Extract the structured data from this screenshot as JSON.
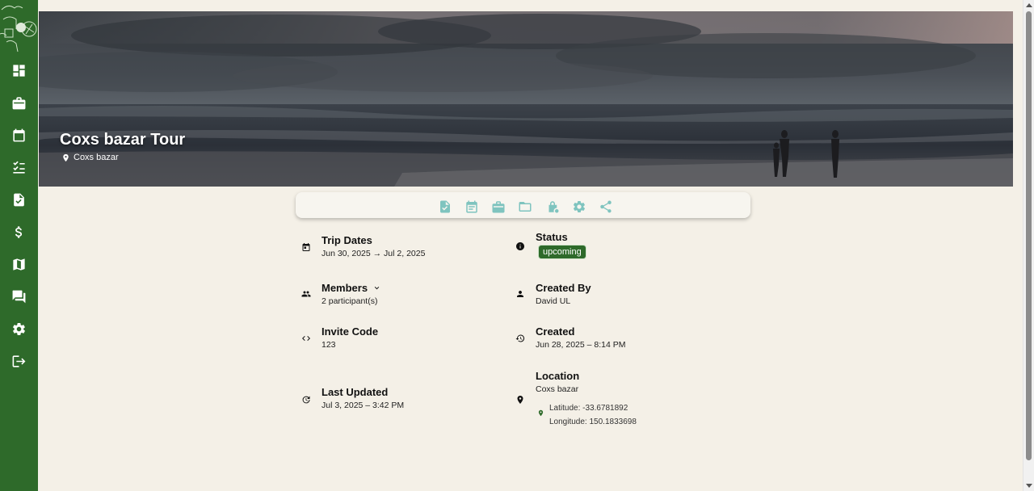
{
  "trip": {
    "title": "Coxs bazar Tour",
    "location": "Coxs bazar"
  },
  "toolbar": {
    "buttons": [
      "checklist",
      "itinerary",
      "luggage",
      "folder",
      "lock-settings",
      "settings",
      "share"
    ],
    "accent": "#7fc4bf"
  },
  "info": {
    "trip_dates": {
      "label": "Trip Dates",
      "value": "Jun 30, 2025 → Jul 2, 2025"
    },
    "status": {
      "label": "Status",
      "value": "upcoming"
    },
    "members": {
      "label": "Members",
      "value": "2 participant(s)"
    },
    "created_by": {
      "label": "Created By",
      "value": "David UL"
    },
    "invite_code": {
      "label": "Invite Code",
      "value": "123"
    },
    "created": {
      "label": "Created",
      "value": "Jun 28, 2025 – 8:14 PM"
    },
    "last_updated": {
      "label": "Last Updated",
      "value": "Jul 3, 2025 – 3:42 PM"
    },
    "location": {
      "label": "Location",
      "value": "Coxs bazar",
      "latitude": "Latitude: -33.6781892",
      "longitude": "Longitude: 150.1833698"
    }
  },
  "colors": {
    "sidebar": "#2e6a2a",
    "background": "#f4f0e7",
    "badge": "#2e6a2a"
  }
}
